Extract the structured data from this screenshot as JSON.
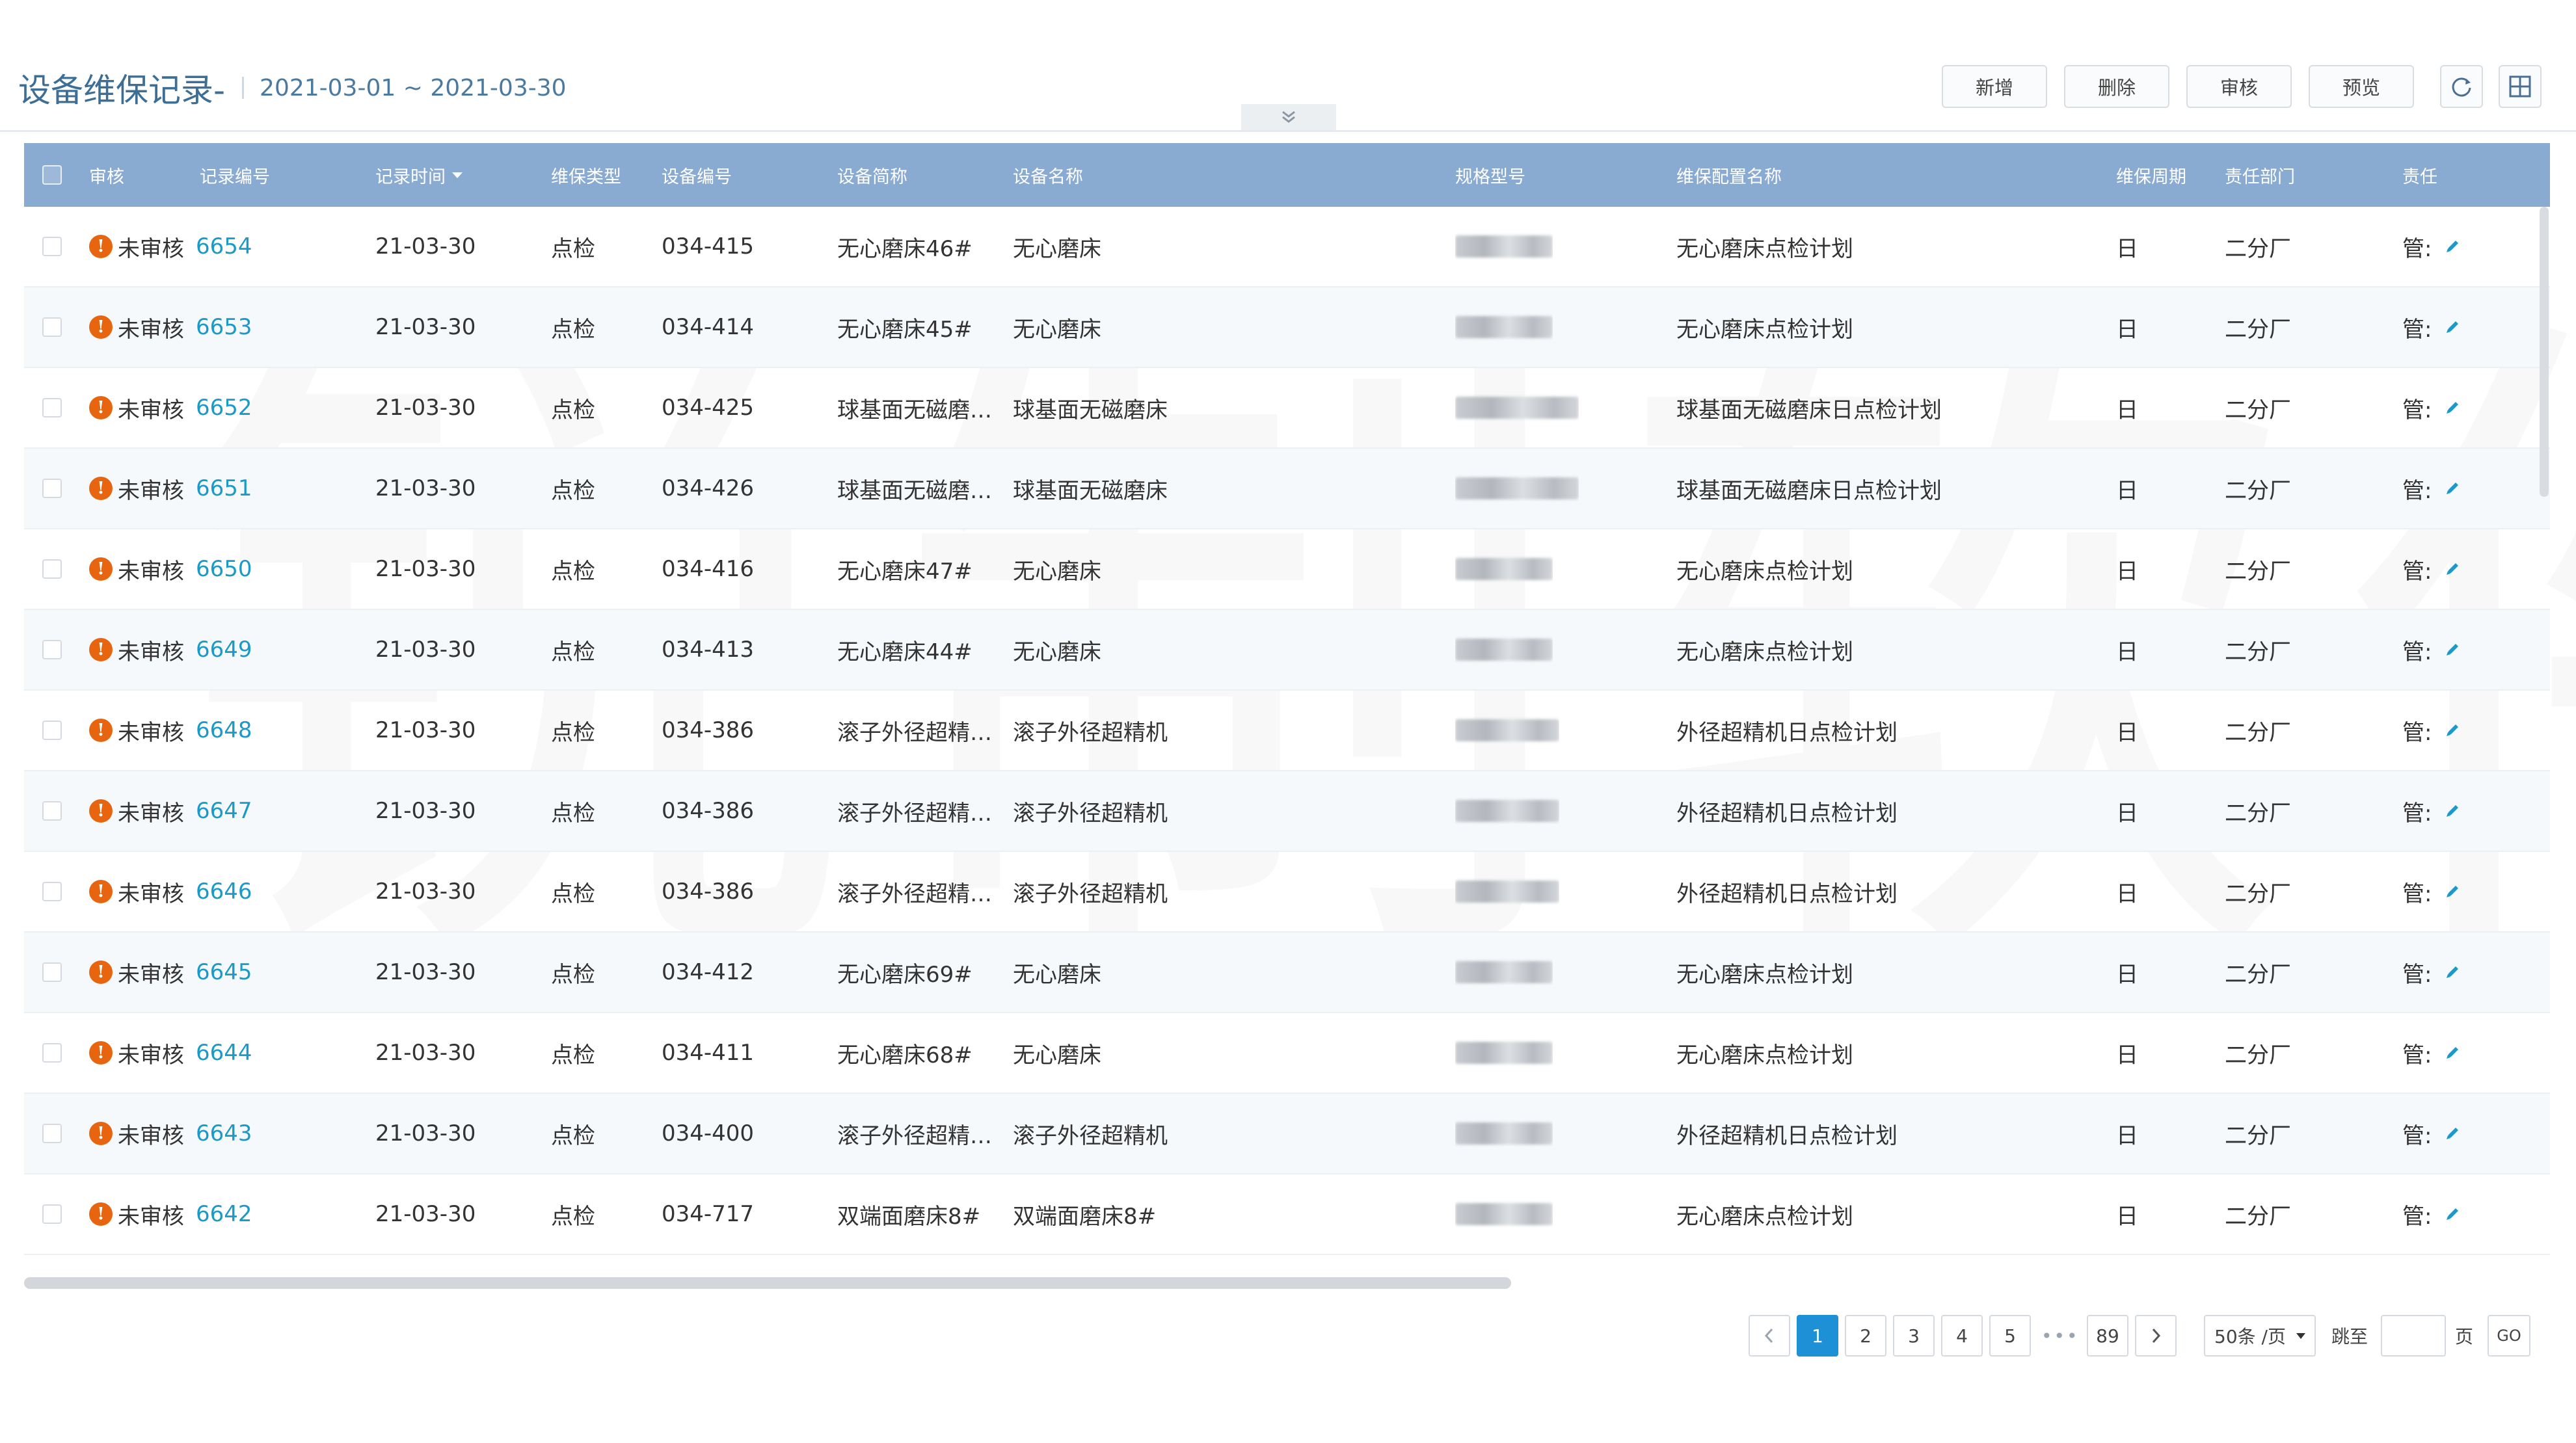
{
  "header": {
    "title": "设备维保记录-",
    "date_range": "2021-03-01 ~ 2021-03-30",
    "buttons": {
      "add": "新增",
      "delete": "删除",
      "audit": "审核",
      "preview": "预览"
    },
    "icons": {
      "refresh": "refresh-icon",
      "layout": "layout-icon",
      "collapse": "chevron-double-down-icon"
    }
  },
  "table": {
    "columns": {
      "status": "审核",
      "record_no": "记录编号",
      "record_time": "记录时间",
      "maint_type": "维保类型",
      "device_no": "设备编号",
      "device_short": "设备简称",
      "device_name": "设备名称",
      "spec": "规格型号",
      "plan_name": "维保配置名称",
      "cycle": "维保周期",
      "dept": "责任部门",
      "owner": "责任"
    },
    "rows": [
      {
        "status": "未审核",
        "record_no": "6654",
        "record_time": "21-03-30",
        "maint_type": "点检",
        "device_no": "034-415",
        "device_short": "无心磨床46#",
        "device_name": "无心磨床",
        "plan_name": "无心磨床点检计划",
        "cycle": "日",
        "dept": "二分厂",
        "owner": "管:"
      },
      {
        "status": "未审核",
        "record_no": "6653",
        "record_time": "21-03-30",
        "maint_type": "点检",
        "device_no": "034-414",
        "device_short": "无心磨床45#",
        "device_name": "无心磨床",
        "plan_name": "无心磨床点检计划",
        "cycle": "日",
        "dept": "二分厂",
        "owner": "管:"
      },
      {
        "status": "未审核",
        "record_no": "6652",
        "record_time": "21-03-30",
        "maint_type": "点检",
        "device_no": "034-425",
        "device_short": "球基面无磁磨…",
        "device_name": "球基面无磁磨床",
        "plan_name": "球基面无磁磨床日点检计划",
        "cycle": "日",
        "dept": "二分厂",
        "owner": "管:"
      },
      {
        "status": "未审核",
        "record_no": "6651",
        "record_time": "21-03-30",
        "maint_type": "点检",
        "device_no": "034-426",
        "device_short": "球基面无磁磨…",
        "device_name": "球基面无磁磨床",
        "plan_name": "球基面无磁磨床日点检计划",
        "cycle": "日",
        "dept": "二分厂",
        "owner": "管:"
      },
      {
        "status": "未审核",
        "record_no": "6650",
        "record_time": "21-03-30",
        "maint_type": "点检",
        "device_no": "034-416",
        "device_short": "无心磨床47#",
        "device_name": "无心磨床",
        "plan_name": "无心磨床点检计划",
        "cycle": "日",
        "dept": "二分厂",
        "owner": "管:"
      },
      {
        "status": "未审核",
        "record_no": "6649",
        "record_time": "21-03-30",
        "maint_type": "点检",
        "device_no": "034-413",
        "device_short": "无心磨床44#",
        "device_name": "无心磨床",
        "plan_name": "无心磨床点检计划",
        "cycle": "日",
        "dept": "二分厂",
        "owner": "管:"
      },
      {
        "status": "未审核",
        "record_no": "6648",
        "record_time": "21-03-30",
        "maint_type": "点检",
        "device_no": "034-386",
        "device_short": "滚子外径超精…",
        "device_name": "滚子外径超精机",
        "plan_name": "外径超精机日点检计划",
        "cycle": "日",
        "dept": "二分厂",
        "owner": "管:"
      },
      {
        "status": "未审核",
        "record_no": "6647",
        "record_time": "21-03-30",
        "maint_type": "点检",
        "device_no": "034-386",
        "device_short": "滚子外径超精…",
        "device_name": "滚子外径超精机",
        "plan_name": "外径超精机日点检计划",
        "cycle": "日",
        "dept": "二分厂",
        "owner": "管:"
      },
      {
        "status": "未审核",
        "record_no": "6646",
        "record_time": "21-03-30",
        "maint_type": "点检",
        "device_no": "034-386",
        "device_short": "滚子外径超精…",
        "device_name": "滚子外径超精机",
        "plan_name": "外径超精机日点检计划",
        "cycle": "日",
        "dept": "二分厂",
        "owner": "管:"
      },
      {
        "status": "未审核",
        "record_no": "6645",
        "record_time": "21-03-30",
        "maint_type": "点检",
        "device_no": "034-412",
        "device_short": "无心磨床69#",
        "device_name": "无心磨床",
        "plan_name": "无心磨床点检计划",
        "cycle": "日",
        "dept": "二分厂",
        "owner": "管:"
      },
      {
        "status": "未审核",
        "record_no": "6644",
        "record_time": "21-03-30",
        "maint_type": "点检",
        "device_no": "034-411",
        "device_short": "无心磨床68#",
        "device_name": "无心磨床",
        "plan_name": "无心磨床点检计划",
        "cycle": "日",
        "dept": "二分厂",
        "owner": "管:"
      },
      {
        "status": "未审核",
        "record_no": "6643",
        "record_time": "21-03-30",
        "maint_type": "点检",
        "device_no": "034-400",
        "device_short": "滚子外径超精…",
        "device_name": "滚子外径超精机",
        "plan_name": "外径超精机日点检计划",
        "cycle": "日",
        "dept": "二分厂",
        "owner": "管:"
      },
      {
        "status": "未审核",
        "record_no": "6642",
        "record_time": "21-03-30",
        "maint_type": "点检",
        "device_no": "034-717",
        "device_short": "双端面磨床8#",
        "device_name": "双端面磨床8#",
        "plan_name": "无心磨床点检计划",
        "cycle": "日",
        "dept": "二分厂",
        "owner": "管:"
      }
    ]
  },
  "pagination": {
    "pages": [
      "1",
      "2",
      "3",
      "4",
      "5"
    ],
    "ellipsis": "•••",
    "last_page": "89",
    "current_page": "1",
    "page_size": "50条 /页",
    "jump_label": "跳至",
    "page_unit": "页",
    "go": "GO"
  },
  "watermark": "锐制软件",
  "colors": {
    "header_bg": "#8aabd1",
    "title": "#3d6f96",
    "link": "#1a9ac9",
    "warning": "#e8650f",
    "active_page": "#1e90d6"
  }
}
